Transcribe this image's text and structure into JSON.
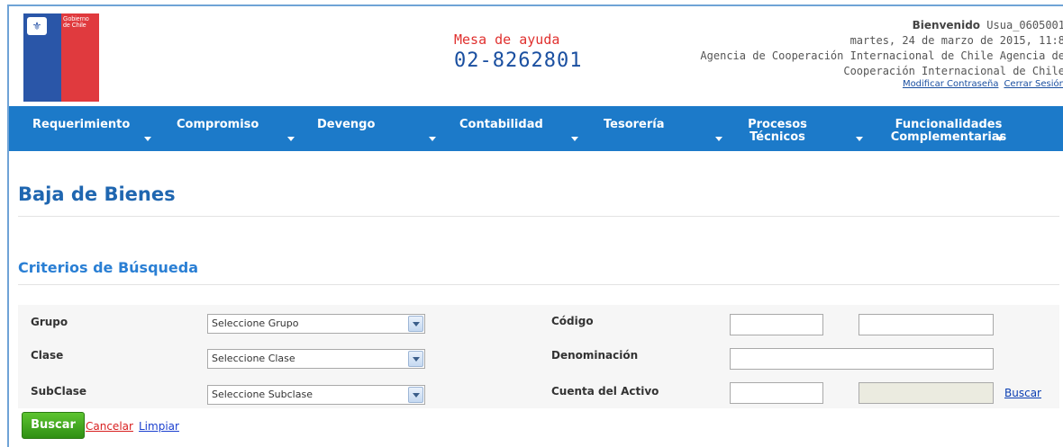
{
  "header": {
    "logo_text": "Gobierno de Chile",
    "help_title": "Mesa de ayuda",
    "help_phone": "02-8262801",
    "welcome_label": "Bienvenido",
    "username": "Usua_0605001",
    "date": "martes, 24 de marzo de 2015, 11:8",
    "agency_line1": "Agencia de Cooperación Internacional de Chile Agencia de",
    "agency_line2": "Cooperación Internacional de Chile",
    "change_password": "Modificar Contraseña",
    "logout": "Cerrar Sesión"
  },
  "nav": {
    "items": [
      {
        "label": "Requerimiento"
      },
      {
        "label": "Compromiso"
      },
      {
        "label": "Devengo"
      },
      {
        "label": "Contabilidad"
      },
      {
        "label": "Tesorería"
      },
      {
        "label": "Procesos Técnicos"
      },
      {
        "label": "Funcionalidades Complementarias"
      }
    ]
  },
  "page": {
    "title": "Baja de Bienes",
    "section_title": "Criterios de Búsqueda"
  },
  "form": {
    "grupo_label": "Grupo",
    "grupo_value": "Seleccione Grupo",
    "clase_label": "Clase",
    "clase_value": "Seleccione Clase",
    "subclase_label": "SubClase",
    "subclase_value": "Seleccione Subclase",
    "codigo_label": "Código",
    "denominacion_label": "Denominación",
    "cuenta_label": "Cuenta del Activo",
    "buscar_link": "Buscar"
  },
  "actions": {
    "search": "Buscar",
    "cancel": "Cancelar",
    "clear": "Limpiar"
  },
  "colors": {
    "nav_bg": "#1c7ac9",
    "title": "#1f66b0",
    "help_red": "#e0312f",
    "button_green": "#3fa61d"
  }
}
